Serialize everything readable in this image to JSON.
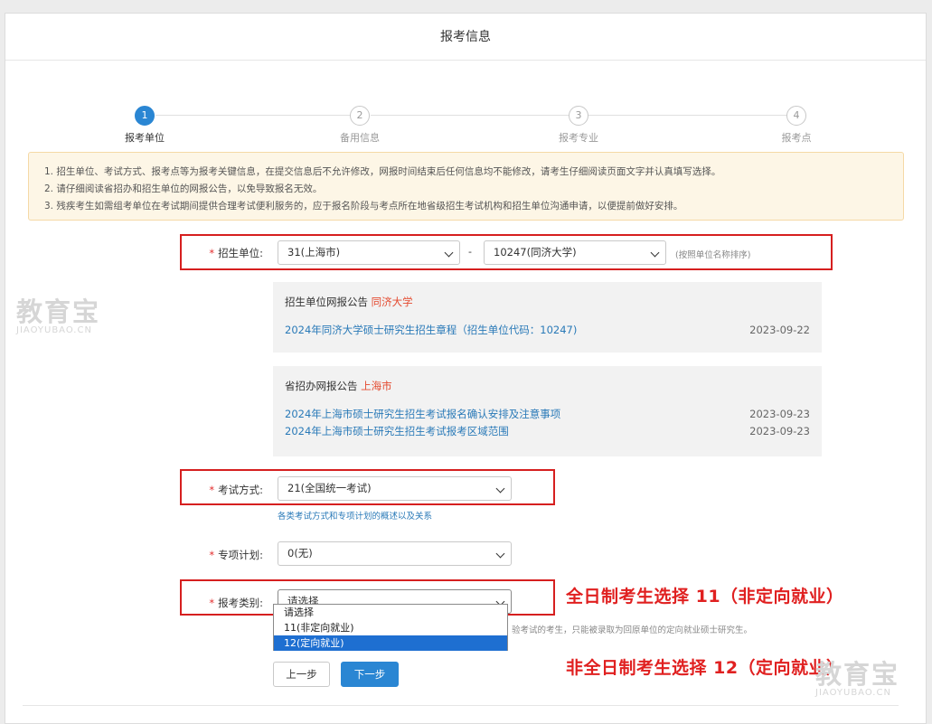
{
  "page_title": "报考信息",
  "steps": [
    {
      "num": "1",
      "label": "报考单位"
    },
    {
      "num": "2",
      "label": "备用信息"
    },
    {
      "num": "3",
      "label": "报考专业"
    },
    {
      "num": "4",
      "label": "报考点"
    }
  ],
  "notice": [
    "1. 招生单位、考试方式、报考点等为报考关键信息，在提交信息后不允许修改，网报时间结束后任何信息均不能修改，请考生仔细阅读页面文字并认真填写选择。",
    "2. 请仔细阅读省招办和招生单位的网报公告，以免导致报名无效。",
    "3. 残疾考生如需组考单位在考试期间提供合理考试便利服务的，应于报名阶段与考点所在地省级招生考试机构和招生单位沟通申请，以便提前做好安排。"
  ],
  "form": {
    "unit_label": "招生单位:",
    "unit_province": "31(上海市)",
    "separator": "-",
    "unit_school": "10247(同济大学)",
    "unit_hint": "(按照单位名称排序)",
    "school_announce": {
      "head": "招生单位网报公告",
      "head_hl": "同济大学",
      "items": [
        {
          "title": "2024年同济大学硕士研究生招生章程（招生单位代码：10247)",
          "date": "2023-09-22"
        }
      ]
    },
    "province_announce": {
      "head": "省招办网报公告",
      "head_hl": "上海市",
      "items": [
        {
          "title": "2024年上海市硕士研究生招生考试报名确认安排及注意事项",
          "date": "2023-09-23"
        },
        {
          "title": "2024年上海市硕士研究生招生考试报考区域范围",
          "date": "2023-09-23"
        }
      ]
    },
    "exam_label": "考试方式:",
    "exam_value": "21(全国统一考试)",
    "exam_link": "各类考试方式和专项计划的概述以及关系",
    "special_label": "专项计划:",
    "special_value": "0(无)",
    "category_label": "报考类别:",
    "category_value": "请选择",
    "category_hint": "验考试的考生，只能被录取为回原单位的定向就业硕士研究生。",
    "category_options": [
      "请选择",
      "11(非定向就业)",
      "12(定向就业)"
    ]
  },
  "buttons": {
    "prev": "上一步",
    "next": "下一步"
  },
  "annotations": {
    "fulltime": "全日制考生选择 11（非定向就业）",
    "parttime": "非全日制考生选择 12（定向就业）"
  },
  "watermark": {
    "cn": "教育宝",
    "en": "JIAOYUBAO.CN"
  }
}
